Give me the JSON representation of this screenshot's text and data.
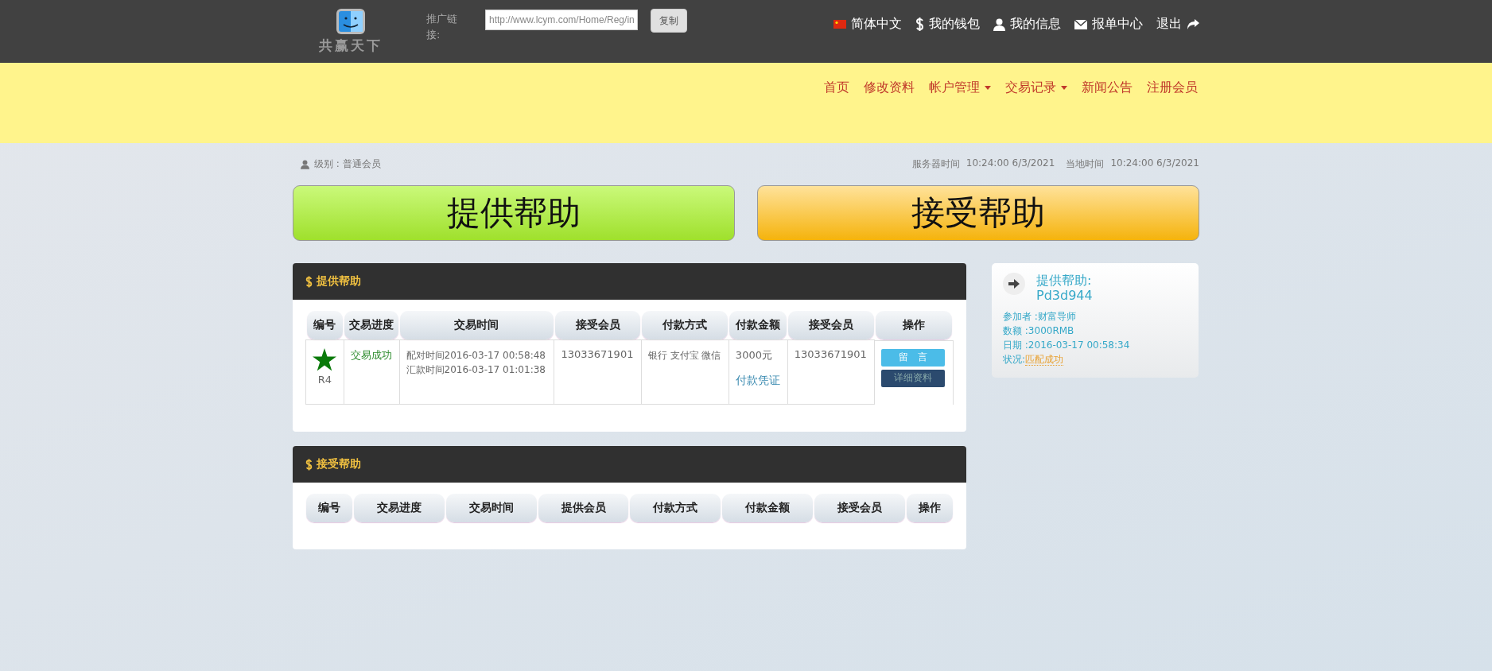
{
  "topbar": {
    "logo_text": "共赢天下",
    "promo_label": "推广链接:",
    "promo_url": "http://www.lcym.com/Home/Reg/in",
    "copy_button": "复制",
    "links": [
      {
        "kind": "flag",
        "label": "简体中文"
      },
      {
        "kind": "dollar",
        "label": "我的钱包"
      },
      {
        "kind": "user",
        "label": "我的信息"
      },
      {
        "kind": "mail",
        "label": "报单中心"
      },
      {
        "kind": "logout",
        "label": "退出"
      }
    ]
  },
  "nav": [
    {
      "label": "首页",
      "dropdown": false
    },
    {
      "label": "修改资料",
      "dropdown": false
    },
    {
      "label": "帐户管理",
      "dropdown": true
    },
    {
      "label": "交易记录",
      "dropdown": true
    },
    {
      "label": "新闻公告",
      "dropdown": false
    },
    {
      "label": "注册会员",
      "dropdown": false
    }
  ],
  "info": {
    "level": "级别 : 普通会员",
    "server_label": "服务器时间",
    "server_time": "10:24:00 6/3/2021",
    "local_label": "当地时间",
    "local_time": "10:24:00 6/3/2021"
  },
  "big_buttons": [
    {
      "kind": "give",
      "label": "提供帮助"
    },
    {
      "kind": "receive",
      "label": "接受帮助"
    }
  ],
  "panels": [
    {
      "title": "提供帮助",
      "columns": [
        "编号",
        "交易进度",
        "交易时间",
        "接受会员",
        "付款方式",
        "付款金额",
        "接受会员",
        "操作"
      ],
      "rows": [
        {
          "rank": "R4",
          "status": "交易成功",
          "times": [
            "配对时间2016-03-17 00:58:48",
            "汇款时间2016-03-17 01:01:38"
          ],
          "member": "13033671901",
          "method": "银行 支付宝 微信",
          "amount": "3000元",
          "proof": "付款凭证",
          "member2": "13033671901",
          "actions": [
            "留　言",
            "详细资料"
          ]
        }
      ]
    },
    {
      "title": "接受帮助",
      "columns": [
        "编号",
        "交易进度",
        "交易时间",
        "提供会员",
        "付款方式",
        "付款金额",
        "接受会员",
        "操作"
      ]
    }
  ],
  "side_card": {
    "title": "提供帮助:",
    "code": "Pd3d944",
    "lines": [
      "参加者 :财富导师",
      "数额 :3000RMB",
      "日期 :2016-03-17 00:58:34"
    ],
    "status_label": "状况:",
    "status_value": "匹配成功"
  }
}
